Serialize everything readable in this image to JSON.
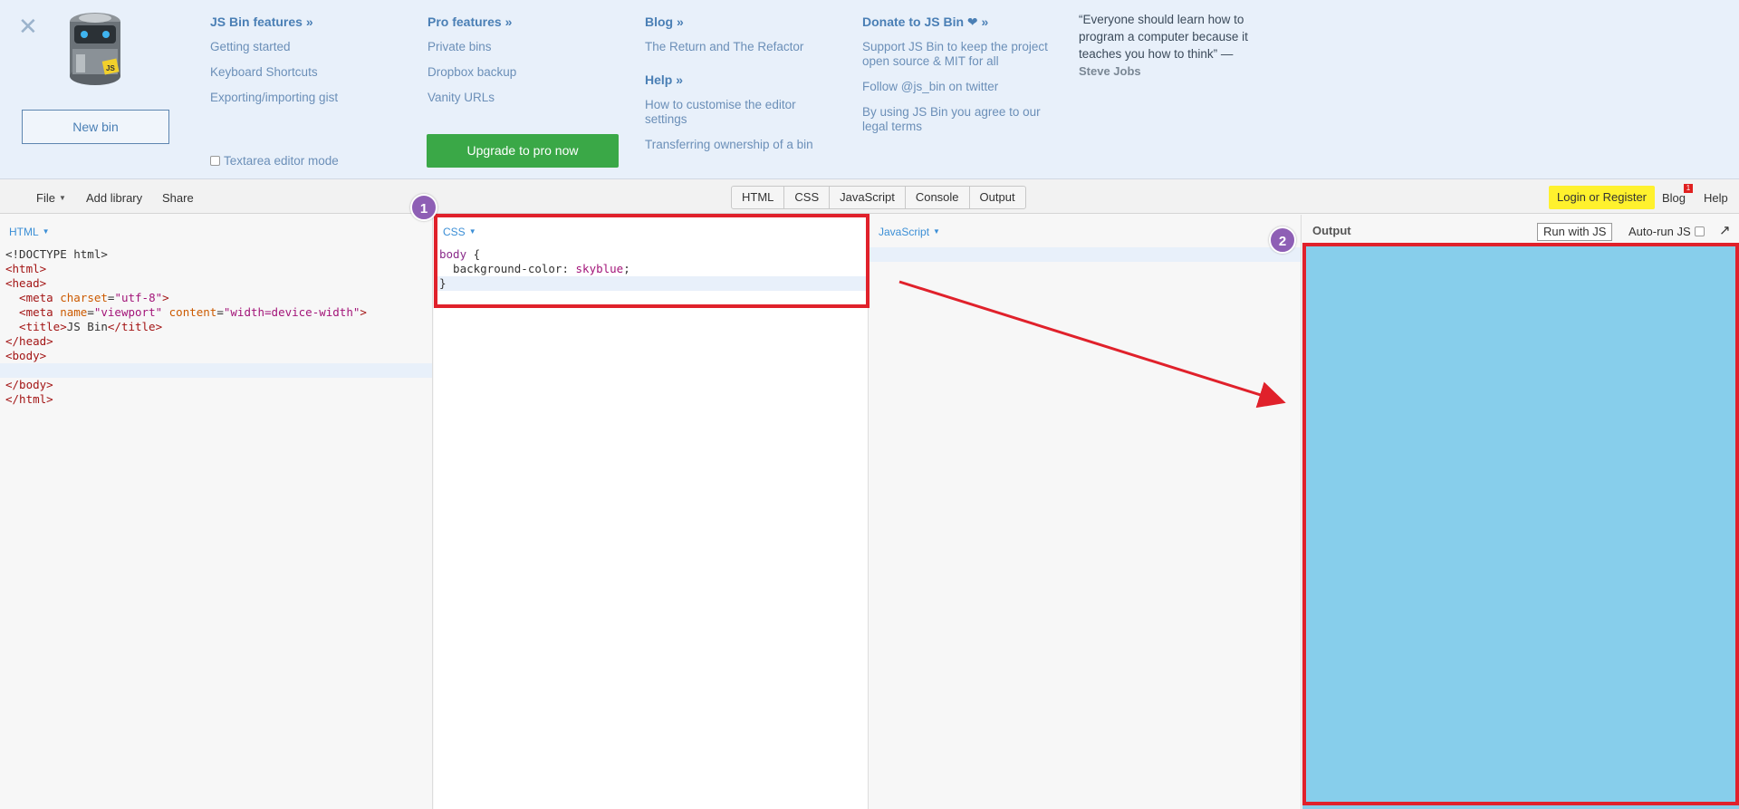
{
  "infocard": {
    "new_bin": "New bin",
    "col1": {
      "head": "JS Bin features »",
      "links": [
        "Getting started",
        "Keyboard Shortcuts",
        "Exporting/importing gist"
      ]
    },
    "col2": {
      "head": "Pro features »",
      "links": [
        "Private bins",
        "Dropbox backup",
        "Vanity URLs"
      ]
    },
    "col3": {
      "head": "Blog »",
      "links": [
        "The Return and The Refactor"
      ],
      "head2": "Help »",
      "links2": [
        "How to customise the editor settings",
        "Transferring ownership of a bin"
      ]
    },
    "col4": {
      "head": "Donate to JS Bin ❤ »",
      "links": [
        "Support JS Bin to keep the project open source & MIT for all",
        "Follow @js_bin on twitter",
        "By using JS Bin you agree to our legal terms"
      ]
    },
    "quote": "“Everyone should learn how to program a computer because it teaches you how to think” —",
    "quote_author": "Steve Jobs",
    "textarea_mode": "Textarea editor mode",
    "upgrade": "Upgrade to pro now",
    "logo_text": "JS"
  },
  "control": {
    "menus": [
      "File",
      "Add library",
      "Share"
    ],
    "panel_tabs": [
      "HTML",
      "CSS",
      "JavaScript",
      "Console",
      "Output"
    ],
    "login": "Login or Register",
    "blog": "Blog",
    "blog_badge": "1",
    "help": "Help"
  },
  "panels": {
    "html_label": "HTML",
    "css_label": "CSS",
    "js_label": "JavaScript",
    "output_label": "Output",
    "run_with_js": "Run with JS",
    "auto_run": "Auto-run JS",
    "popout_icon": "↗",
    "output_bg": "#87ceeb"
  },
  "html_code": {
    "l1": "<!DOCTYPE html>",
    "l2": "<html>",
    "l3": "<head>",
    "l4a": "  <meta ",
    "l4b": "charset",
    "l4c": "=",
    "l4d": "\"utf-8\"",
    "l4e": ">",
    "l5a": "  <meta ",
    "l5b": "name",
    "l5c": "=",
    "l5d": "\"viewport\"",
    "l5e": " ",
    "l5f": "content",
    "l5g": "=",
    "l5h": "\"width=device-width\"",
    "l5i": ">",
    "l6a": "  <title>",
    "l6b": "JS Bin",
    "l6c": "</title>",
    "l7": "</head>",
    "l8": "<body>",
    "l9": "",
    "l10": "</body>",
    "l11": "</html>"
  },
  "css_code": {
    "l1a": "body",
    "l1b": " {",
    "l2a": "  background-color: ",
    "l2b": "skyblue",
    "l2c": ";",
    "l3": "}"
  },
  "annotations": {
    "badge1": "1",
    "badge2": "2"
  },
  "colors": {
    "annotation": "#e0212b",
    "badge": "#8e5fb5",
    "accent": "#4a7fb5",
    "upgrade": "#3aa847",
    "login": "#fff12d"
  }
}
